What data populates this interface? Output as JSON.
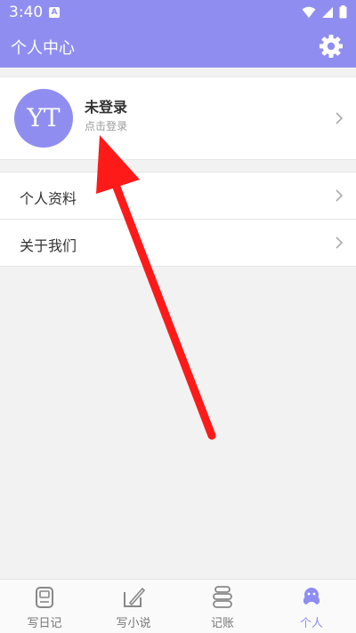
{
  "status_bar": {
    "time": "3:40",
    "app_badge": "A"
  },
  "header": {
    "title": "个人中心"
  },
  "profile": {
    "avatar_text": "YT",
    "name": "未登录",
    "subtitle": "点击登录"
  },
  "menu": {
    "items": [
      {
        "label": "个人资料"
      },
      {
        "label": "关于我们"
      }
    ]
  },
  "bottom_nav": {
    "tabs": [
      {
        "label": "写日记",
        "icon": "diary-icon"
      },
      {
        "label": "写小说",
        "icon": "novel-icon"
      },
      {
        "label": "记账",
        "icon": "coins-icon"
      },
      {
        "label": "个人",
        "icon": "person-icon",
        "active": true
      }
    ]
  },
  "colors": {
    "accent": "#8f8ef0",
    "annotation_arrow": "#ff1a1a",
    "background": "#f2f2f2"
  }
}
